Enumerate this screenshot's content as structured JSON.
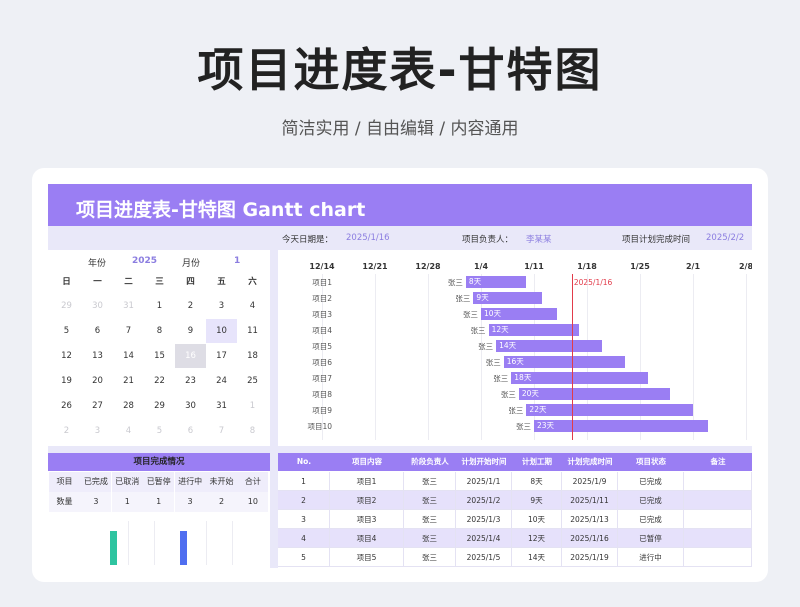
{
  "hero": {
    "title": "项目进度表-甘特图",
    "subtitle": "简洁实用 / 自由编辑 / 内容通用"
  },
  "banner": {
    "title": "项目进度表-甘特图 Gantt chart"
  },
  "info": {
    "today_label": "今天日期是：",
    "today_value": "2025/1/16",
    "owner_label": "项目负责人：",
    "owner_value": "李某某",
    "plan_end_label": "项目计划完成时间",
    "plan_end_value": "2025/2/2"
  },
  "calendar": {
    "year_label": "年份",
    "year": "2025",
    "month_label": "月份",
    "month": "1",
    "weekdays": [
      "日",
      "一",
      "二",
      "三",
      "四",
      "五",
      "六"
    ],
    "weeks": [
      [
        "29",
        "30",
        "31",
        "1",
        "2",
        "3",
        "4"
      ],
      [
        "5",
        "6",
        "7",
        "8",
        "9",
        "10",
        "11"
      ],
      [
        "12",
        "13",
        "14",
        "15",
        "16",
        "17",
        "18"
      ],
      [
        "19",
        "20",
        "21",
        "22",
        "23",
        "24",
        "25"
      ],
      [
        "26",
        "27",
        "28",
        "29",
        "30",
        "31",
        "1"
      ],
      [
        "2",
        "3",
        "4",
        "5",
        "6",
        "7",
        "8"
      ]
    ]
  },
  "gantt": {
    "axis_ticks": [
      "12/14",
      "12/21",
      "12/28",
      "1/4",
      "1/11",
      "1/18",
      "1/25",
      "2/1",
      "2/8"
    ],
    "today_label": "2025/1/16",
    "tasks": [
      {
        "name": "项目1",
        "owner": "张三",
        "duration_label": "8天"
      },
      {
        "name": "项目2",
        "owner": "张三",
        "duration_label": "9天"
      },
      {
        "name": "项目3",
        "owner": "张三",
        "duration_label": "10天"
      },
      {
        "name": "项目4",
        "owner": "张三",
        "duration_label": "12天"
      },
      {
        "name": "项目5",
        "owner": "张三",
        "duration_label": "14天"
      },
      {
        "name": "项目6",
        "owner": "张三",
        "duration_label": "16天"
      },
      {
        "name": "项目7",
        "owner": "张三",
        "duration_label": "18天"
      },
      {
        "name": "项目8",
        "owner": "张三",
        "duration_label": "20天"
      },
      {
        "name": "项目9",
        "owner": "张三",
        "duration_label": "22天"
      },
      {
        "name": "项目10",
        "owner": "张三",
        "duration_label": "23天"
      }
    ]
  },
  "summary": {
    "title": "项目完成情况",
    "headers": [
      "项目",
      "已完成",
      "已取消",
      "已暂停",
      "进行中",
      "未开始",
      "合计"
    ],
    "values": [
      "数量",
      "3",
      "1",
      "1",
      "3",
      "2",
      "10"
    ],
    "colors": {
      "completed": "#2ec4a0",
      "in_progress": "#4f6ef0"
    }
  },
  "table": {
    "headers": [
      "No.",
      "项目内容",
      "阶段负责人",
      "计划开始时间",
      "计划工期",
      "计划完成时间",
      "项目状态",
      "备注"
    ],
    "rows": [
      [
        "1",
        "项目1",
        "张三",
        "2025/1/1",
        "8天",
        "2025/1/9",
        "已完成",
        ""
      ],
      [
        "2",
        "项目2",
        "张三",
        "2025/1/2",
        "9天",
        "2025/1/11",
        "已完成",
        ""
      ],
      [
        "3",
        "项目3",
        "张三",
        "2025/1/3",
        "10天",
        "2025/1/13",
        "已完成",
        ""
      ],
      [
        "4",
        "项目4",
        "张三",
        "2025/1/4",
        "12天",
        "2025/1/16",
        "已暂停",
        ""
      ],
      [
        "5",
        "项目5",
        "张三",
        "2025/1/5",
        "14天",
        "2025/1/19",
        "进行中",
        ""
      ]
    ]
  },
  "colors": {
    "accent": "#9a7ef3",
    "today_line": "#e23b4a"
  }
}
